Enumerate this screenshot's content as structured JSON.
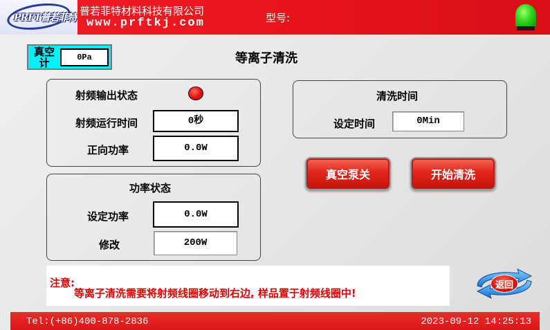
{
  "header": {
    "logo_text": "PRFT普若菲特",
    "company_name": "普若菲特材料科技有限公司",
    "website": "www.prftkj.com",
    "model_label": "型号:",
    "status_lamp_color": "#2fd41e"
  },
  "vacuum": {
    "label": "真空计",
    "value": "0Pa",
    "bg_color": "#00f0ff"
  },
  "page_title": "等离子清洗",
  "rf_status": {
    "output_state_label": "射频输出状态",
    "output_state_color": "#e01010",
    "run_time_label": "射频运行时间",
    "run_time_value": "0秒",
    "forward_power_label": "正向功率",
    "forward_power_value": "0.0W"
  },
  "power_status": {
    "title": "功率状态",
    "set_power_label": "设定功率",
    "set_power_value": "0.0W",
    "modify_label": "修改",
    "modify_value": "200W"
  },
  "cleaning_time": {
    "title": "清洗时间",
    "set_time_label": "设定时间",
    "set_time_value": "0Min"
  },
  "buttons": {
    "vacuum_pump": "真空泵关",
    "start_cleaning": "开始清洗",
    "back": "返回",
    "accent_color": "#e2261c"
  },
  "notice": {
    "title": "注意:",
    "text": "等离子清洗需要将射频线圈移动到右边, 样品置于射频线圈中!"
  },
  "footer": {
    "tel": "Tel:(+86)400-878-2836",
    "datetime": "2023-09-12 14:25:13"
  }
}
